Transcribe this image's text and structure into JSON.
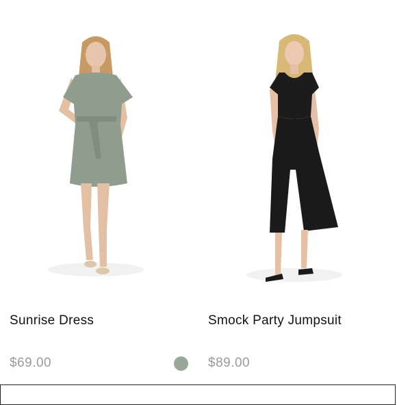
{
  "products": [
    {
      "name": "Sunrise Dress",
      "price": "$69.00",
      "swatch_color": "#98a798",
      "image_icon": "sage-green-tshirt-dress-photo"
    },
    {
      "name": "Smock Party Jumpsuit",
      "price": "$89.00",
      "image_icon": "black-wide-leg-jumpsuit-photo"
    }
  ]
}
